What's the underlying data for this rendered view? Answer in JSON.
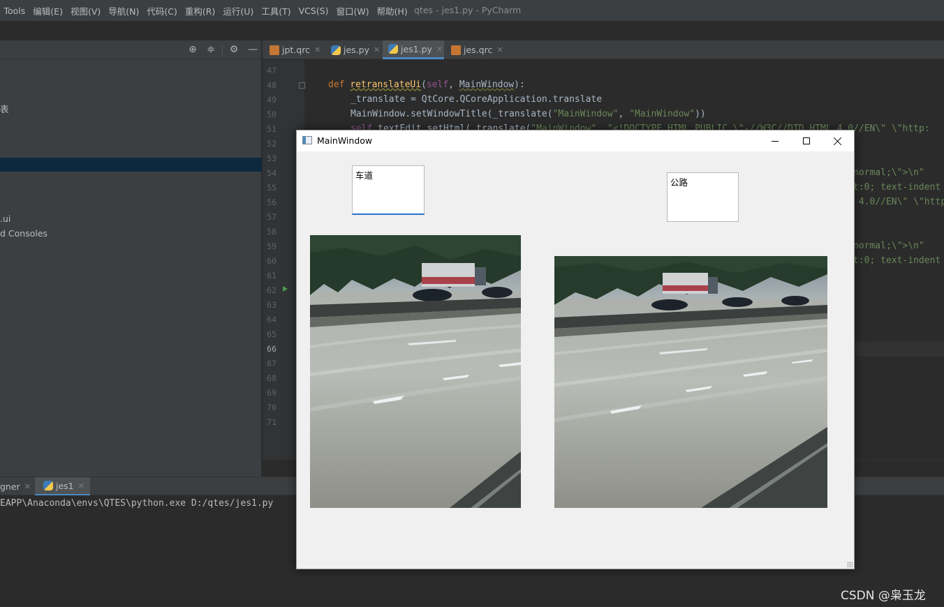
{
  "menubar": {
    "items": [
      "Tools",
      "编辑(E)",
      "视图(V)",
      "导航(N)",
      "代码(C)",
      "重构(R)",
      "运行(U)",
      "工具(T)",
      "VCS(S)",
      "窗口(W)",
      "帮助(H)"
    ],
    "title": "qtes - jes1.py - PyCharm"
  },
  "project_tree": {
    "row1": "表",
    "row2": ".ui",
    "row3": "d Consoles"
  },
  "editor_tabs": [
    {
      "label": "jpt.qrc",
      "type": "qrc"
    },
    {
      "label": "jes.py",
      "type": "py"
    },
    {
      "label": "jes1.py",
      "type": "py"
    },
    {
      "label": "jes.qrc",
      "type": "qrc"
    }
  ],
  "editor": {
    "line_numbers": [
      "47",
      "48",
      "49",
      "50",
      "51",
      "52",
      "53",
      "54",
      "55",
      "56",
      "57",
      "58",
      "59",
      "60",
      "61",
      "62",
      "63",
      "64",
      "65",
      "66",
      "67",
      "68",
      "69",
      "70",
      "71"
    ],
    "current_line": "66",
    "code": {
      "l48_def": "def",
      "l48_fn": "retranslateUi",
      "l48_open": "(",
      "l48_self": "self",
      "l48_mid": ", ",
      "l48_param": "MainWindow",
      "l48_close": "):",
      "l49": "_translate = QtCore.QCoreApplication.translate",
      "l50_a": "MainWindow.setWindowTitle(_translate(",
      "l50_s1": "\"MainWindow\"",
      "l50_b": ", ",
      "l50_s2": "\"MainWindow\"",
      "l50_c": "))",
      "l51_self": "self",
      "l51_a": ".textEdit.setHtml(_translate(",
      "l51_s1": "\"MainWindow\"",
      "l51_b": ", ",
      "l51_s2": "\"<!DOCTYPE HTML PUBLIC \\\"-//W3C//DTD HTML 4.0//EN\\\" \\\"http:",
      "frag54": "normal;\\\">\\n\"",
      "frag55": "t:0; text-indent",
      "frag56": " 4.0//EN\\\" \\\"http",
      "frag59": "normal;\\\">\\n\"",
      "frag60": "t:0; text-indent"
    }
  },
  "run_panel": {
    "tab1": "gner",
    "tab2": "jes1",
    "command": "EAPP\\Anaconda\\envs\\QTES\\python.exe D:/qtes/jes1.py"
  },
  "qt_window": {
    "title": "MainWindow",
    "text_left": "车道",
    "text_right": "公路"
  },
  "watermark": "CSDN @枭玉龙",
  "colors": {
    "ide_bg": "#2b2b2b",
    "panel_bg": "#3c3f41",
    "keyword": "#cc7832",
    "function": "#ffc66d",
    "string": "#6a8759",
    "self": "#94558d",
    "qt_bg": "#f0f0f0"
  }
}
